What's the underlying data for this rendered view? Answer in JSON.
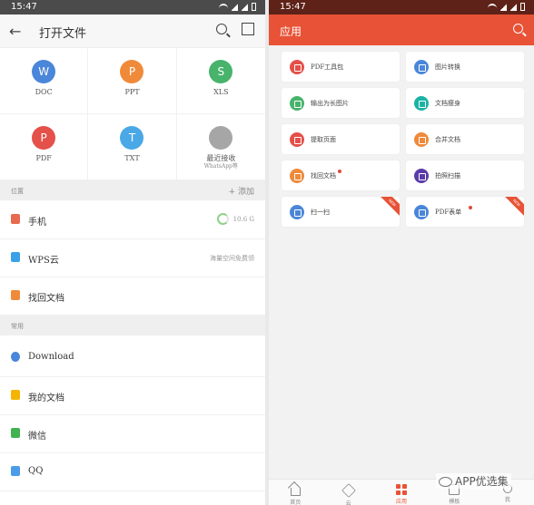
{
  "left": {
    "status_time": "15:47",
    "header": {
      "title": "打开文件"
    },
    "file_types": [
      {
        "label": "DOC",
        "glyph": "W",
        "color": "#4a86d9",
        "icon": "doc-icon"
      },
      {
        "label": "PPT",
        "glyph": "P",
        "color": "#ef8a3a",
        "icon": "ppt-icon"
      },
      {
        "label": "XLS",
        "glyph": "S",
        "color": "#47b36b",
        "icon": "xls-icon"
      },
      {
        "label": "PDF",
        "glyph": "P",
        "color": "#e4504a",
        "icon": "pdf-icon"
      },
      {
        "label": "TXT",
        "glyph": "T",
        "color": "#4aa8e6",
        "icon": "txt-icon"
      },
      {
        "label": "最近接收",
        "sub": "WhatsApp等",
        "glyph": "",
        "color": "#a6a6a6",
        "icon": "recent-received-icon"
      }
    ],
    "location_section": {
      "label": "位置",
      "add_label": "+ 添加"
    },
    "locations": [
      {
        "label": "手机",
        "right": "10.6 G",
        "color": "#e86a4f"
      },
      {
        "label": "WPS云",
        "right": "海量空间免费领",
        "color": "#3aa0e8"
      },
      {
        "label": "找回文档",
        "right": "",
        "color": "#ef8a3a"
      }
    ],
    "common_section": {
      "label": "常用"
    },
    "common": [
      {
        "label": "Download",
        "color": "#4a86d9"
      },
      {
        "label": "我的文档",
        "color": "#f4b400"
      },
      {
        "label": "微信",
        "color": "#3fb34f"
      },
      {
        "label": "QQ",
        "color": "#4a9be8"
      }
    ]
  },
  "right": {
    "status_time": "15:47",
    "header": {
      "title": "应用"
    },
    "tiles": [
      {
        "label": "PDF工具包",
        "color": "#e4504a",
        "dot": false,
        "ribbon": false
      },
      {
        "label": "图片转换",
        "color": "#4a86d9",
        "dot": false,
        "ribbon": false
      },
      {
        "label": "输出为长图片",
        "color": "#47b36b",
        "dot": false,
        "ribbon": false
      },
      {
        "label": "文档瘦身",
        "color": "#1bb3a5",
        "dot": false,
        "ribbon": false
      },
      {
        "label": "提取页面",
        "color": "#e4504a",
        "dot": false,
        "ribbon": false
      },
      {
        "label": "合并文档",
        "color": "#ef8a3a",
        "dot": false,
        "ribbon": false
      },
      {
        "label": "找回文档",
        "color": "#ef8a3a",
        "dot": true,
        "ribbon": false
      },
      {
        "label": "拍照扫描",
        "color": "#5b3ca8",
        "dot": false,
        "ribbon": false
      },
      {
        "label": "扫一扫",
        "color": "#4a86d9",
        "dot": false,
        "ribbon": true
      },
      {
        "label": "PDF表单",
        "color": "#4a86d9",
        "dot": true,
        "ribbon": true
      }
    ],
    "ribbon_text": "NEW",
    "nav": [
      {
        "label": "首页",
        "key": "home"
      },
      {
        "label": "云",
        "key": "cloud"
      },
      {
        "label": "应用",
        "key": "apps"
      },
      {
        "label": "模板",
        "key": "tpl"
      },
      {
        "label": "我",
        "key": "me"
      }
    ]
  },
  "watermark": "APP优选集"
}
